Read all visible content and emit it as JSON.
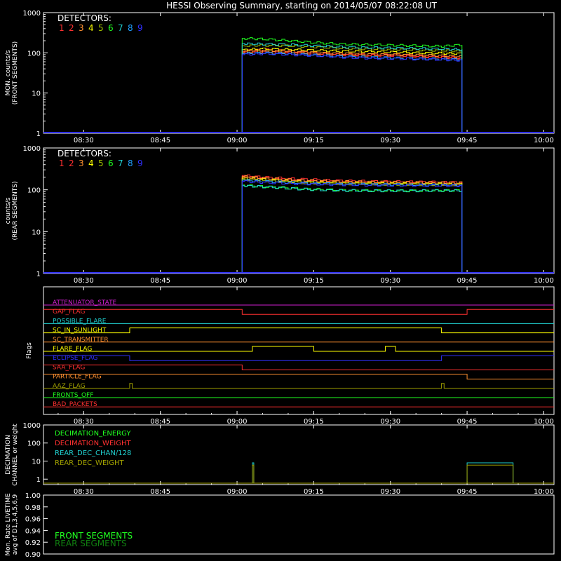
{
  "title": "HESSI Observing Summary, starting on 2014/05/07 08:22:08 UT",
  "time_axis": {
    "start": "08:22:08",
    "end": "10:02:00",
    "tick_labels": [
      "08:30",
      "08:45",
      "09:00",
      "09:15",
      "09:30",
      "09:45",
      "10:00"
    ],
    "tick_times": [
      "08:30",
      "08:45",
      "09:00",
      "09:15",
      "09:30",
      "09:45",
      "10:00"
    ]
  },
  "colors": {
    "background": "#000000",
    "axes": "#ffffff",
    "detectors": [
      "#ff3030",
      "#ff3030",
      "#ff9030",
      "#ffff00",
      "#a0c000",
      "#20ff20",
      "#20d0d0",
      "#20a0ff",
      "#3030ff"
    ]
  },
  "detectors_label": "DETECTORS:",
  "detector_numbers": [
    "1",
    "2",
    "3",
    "4",
    "5",
    "6",
    "7",
    "8",
    "9"
  ],
  "chart_data": [
    {
      "type": "line",
      "panel": "front",
      "ylabel": "MON. counts/s",
      "ylabel2": "(FRONT SEGMENTS)",
      "yscale": "log",
      "ylim": [
        1,
        1000
      ],
      "y_tick_labels": [
        "1",
        "10",
        "100",
        "1000"
      ],
      "x": [
        "09:01",
        "09:05",
        "09:10",
        "09:15",
        "09:20",
        "09:25",
        "09:30",
        "09:35",
        "09:40",
        "09:44"
      ],
      "series": [
        {
          "name": "1",
          "values": [
            110,
            120,
            110,
            100,
            95,
            90,
            90,
            85,
            80,
            75
          ]
        },
        {
          "name": "2",
          "values": [
            100,
            105,
            100,
            95,
            90,
            85,
            85,
            80,
            78,
            72
          ]
        },
        {
          "name": "3",
          "values": [
            105,
            110,
            105,
            100,
            95,
            92,
            90,
            88,
            85,
            80
          ]
        },
        {
          "name": "4",
          "values": [
            120,
            125,
            120,
            115,
            110,
            108,
            105,
            100,
            98,
            95
          ]
        },
        {
          "name": "5",
          "values": [
            150,
            155,
            150,
            140,
            130,
            125,
            122,
            118,
            115,
            110
          ]
        },
        {
          "name": "6",
          "values": [
            230,
            220,
            200,
            180,
            165,
            160,
            155,
            150,
            145,
            160
          ]
        },
        {
          "name": "7",
          "values": [
            170,
            165,
            160,
            150,
            140,
            135,
            132,
            128,
            125,
            120
          ]
        },
        {
          "name": "8",
          "values": [
            95,
            100,
            95,
            88,
            82,
            78,
            75,
            72,
            70,
            68
          ]
        },
        {
          "name": "9",
          "values": [
            90,
            95,
            90,
            85,
            78,
            74,
            72,
            70,
            68,
            65
          ]
        }
      ]
    },
    {
      "type": "line",
      "panel": "rear",
      "ylabel": "counts/s",
      "ylabel2": "(REAR SEGMENTS)",
      "yscale": "log",
      "ylim": [
        1,
        1000
      ],
      "y_tick_labels": [
        "1",
        "10",
        "100",
        "1000"
      ],
      "x": [
        "09:01",
        "09:05",
        "09:10",
        "09:15",
        "09:20",
        "09:25",
        "09:30",
        "09:35",
        "09:40",
        "09:44"
      ],
      "series": [
        {
          "name": "1",
          "values": [
            220,
            200,
            185,
            175,
            165,
            160,
            158,
            155,
            152,
            150
          ]
        },
        {
          "name": "2",
          "values": [
            200,
            185,
            170,
            160,
            155,
            150,
            148,
            146,
            144,
            142
          ]
        },
        {
          "name": "3",
          "values": [
            210,
            190,
            175,
            165,
            158,
            155,
            152,
            150,
            148,
            146
          ]
        },
        {
          "name": "4",
          "values": [
            190,
            175,
            160,
            150,
            145,
            142,
            140,
            138,
            137,
            135
          ]
        },
        {
          "name": "5",
          "values": [
            180,
            165,
            152,
            145,
            140,
            138,
            136,
            134,
            133,
            132
          ]
        },
        {
          "name": "6",
          "values": [
            130,
            120,
            110,
            102,
            98,
            96,
            95,
            95,
            96,
            97
          ]
        },
        {
          "name": "7",
          "values": [
            125,
            118,
            108,
            100,
            97,
            95,
            95,
            95,
            96,
            96
          ]
        },
        {
          "name": "8",
          "values": [
            170,
            160,
            150,
            142,
            138,
            135,
            133,
            132,
            130,
            130
          ]
        },
        {
          "name": "9",
          "values": [
            160,
            150,
            142,
            136,
            132,
            130,
            128,
            127,
            126,
            125
          ]
        }
      ]
    },
    {
      "type": "line",
      "panel": "flags",
      "ylabel": "Flags",
      "flags": [
        {
          "name": "ATTENUATOR_STATE",
          "color": "#d020d0",
          "steps": [
            [
              "start",
              0
            ]
          ]
        },
        {
          "name": "GAP_FLAG",
          "color": "#ff3030",
          "steps": [
            [
              "start",
              1
            ],
            [
              "09:01",
              0
            ],
            [
              "09:45",
              1
            ]
          ]
        },
        {
          "name": "POSSIBLE_FLARE",
          "color": "#20d0d0",
          "steps": [
            [
              "start",
              0
            ]
          ]
        },
        {
          "name": "SC_IN_SUNLIGHT",
          "color": "#ffff00",
          "steps": [
            [
              "start",
              0
            ],
            [
              "08:39",
              1
            ],
            [
              "09:40",
              0
            ]
          ]
        },
        {
          "name": "SC_TRANSMITTER",
          "color": "#ff9030",
          "steps": [
            [
              "start",
              0
            ]
          ]
        },
        {
          "name": "FLARE_FLAG",
          "color": "#ffff00",
          "steps": [
            [
              "start",
              0
            ],
            [
              "09:03",
              1
            ],
            [
              "09:15",
              0
            ],
            [
              "09:29",
              1
            ],
            [
              "09:31",
              0
            ]
          ]
        },
        {
          "name": "ECLIPSE_FLAG",
          "color": "#3030ff",
          "steps": [
            [
              "start",
              1
            ],
            [
              "08:39",
              0
            ],
            [
              "09:40",
              1
            ]
          ]
        },
        {
          "name": "SAA_FLAG",
          "color": "#ff3030",
          "steps": [
            [
              "start",
              1
            ],
            [
              "09:01",
              0
            ]
          ]
        },
        {
          "name": "PARTICLE_FLAG",
          "color": "#ff9030",
          "steps": [
            [
              "start",
              1
            ],
            [
              "09:45",
              0
            ]
          ]
        },
        {
          "name": "AAZ_FLAG",
          "color": "#a0a000",
          "steps": [
            [
              "start",
              0
            ],
            [
              "08:39",
              1
            ],
            [
              "08:39:30",
              0
            ],
            [
              "09:40",
              1
            ],
            [
              "09:40:30",
              0
            ]
          ]
        },
        {
          "name": "FRONTS_OFF",
          "color": "#20ff20",
          "steps": [
            [
              "start",
              0
            ]
          ]
        },
        {
          "name": "BAD_PACKETS",
          "color": "#ff3030",
          "steps": [
            [
              "start",
              0
            ]
          ]
        }
      ]
    },
    {
      "type": "line",
      "panel": "decimation",
      "ylabel": "DECIMATION",
      "ylabel2": "CHANNEL or weight",
      "yscale": "log",
      "ylim": [
        0.5,
        1000
      ],
      "y_tick_labels": [
        "1",
        "10",
        "100",
        "1000"
      ],
      "series": [
        {
          "name": "DECIMATION_ENERGY",
          "color": "#20ff20",
          "values": [
            0
          ]
        },
        {
          "name": "DECIMATION_WEIGHT",
          "color": "#ff3030",
          "values": [
            0
          ]
        },
        {
          "name": "REAR_DEC_CHAN/128",
          "color": "#20d0d0",
          "spikes": [
            [
              "09:03",
              8
            ],
            [
              "09:45",
              8,
              "09:54"
            ]
          ]
        },
        {
          "name": "REAR_DEC_WEIGHT",
          "color": "#a0a000",
          "spikes": [
            [
              "09:03",
              6
            ],
            [
              "09:45",
              6,
              "09:54"
            ]
          ]
        }
      ]
    },
    {
      "type": "line",
      "panel": "livetime",
      "ylabel": "Mon. Rate LIVETIME",
      "ylabel2": "avg of D1,3,4,5,6,9",
      "ylim": [
        0.9,
        1.0
      ],
      "y_tick_labels": [
        "0.90",
        "0.92",
        "0.94",
        "0.96",
        "0.98",
        "1.00"
      ],
      "series": [
        {
          "name": "FRONT SEGMENTS",
          "color": "#20ff20",
          "values": []
        },
        {
          "name": "REAR SEGMENTS",
          "color": "#108010",
          "values": []
        }
      ]
    }
  ]
}
